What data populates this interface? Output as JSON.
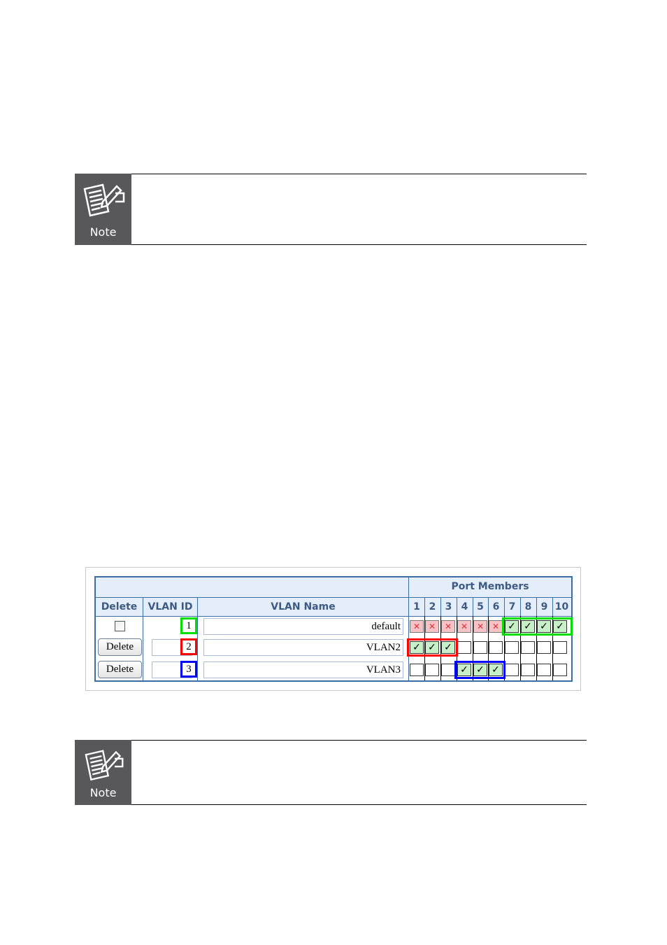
{
  "notes": [
    {
      "label": "Note",
      "icon": "note-pencil-icon"
    },
    {
      "label": "Note",
      "icon": "note-pencil-icon"
    }
  ],
  "vlan_table": {
    "group_header": "Port Members",
    "headers": {
      "delete": "Delete",
      "vlan_id": "VLAN ID",
      "vlan_name": "VLAN Name"
    },
    "ports": [
      "1",
      "2",
      "3",
      "4",
      "5",
      "6",
      "7",
      "8",
      "9",
      "10"
    ],
    "rows": [
      {
        "delete_type": "checkbox",
        "delete_label": "",
        "vlan_id": "1",
        "vlan_name": "default",
        "id_highlight": "#00e000",
        "members": [
          "no",
          "no",
          "no",
          "no",
          "no",
          "no",
          "yes",
          "yes",
          "yes",
          "yes"
        ]
      },
      {
        "delete_type": "button",
        "delete_label": "Delete",
        "vlan_id": "2",
        "vlan_name": "VLAN2",
        "id_highlight": "#ff0000",
        "members": [
          "yes",
          "yes",
          "yes",
          "none",
          "none",
          "none",
          "none",
          "none",
          "none",
          "none"
        ]
      },
      {
        "delete_type": "button",
        "delete_label": "Delete",
        "vlan_id": "3",
        "vlan_name": "VLAN3",
        "id_highlight": "#0000ff",
        "members": [
          "none",
          "none",
          "none",
          "yes",
          "yes",
          "yes",
          "none",
          "none",
          "none",
          "none"
        ]
      }
    ],
    "highlights": [
      {
        "row": 0,
        "from_port": 7,
        "to_port": 10,
        "color": "#00e000"
      },
      {
        "row": 1,
        "from_port": 1,
        "to_port": 3,
        "color": "#ff0000"
      },
      {
        "row": 2,
        "from_port": 4,
        "to_port": 6,
        "color": "#0000ff"
      }
    ],
    "symbols": {
      "yes": "✓",
      "no": "✕"
    },
    "colors": {
      "header_bg": "#e4eefa",
      "header_text": "#3e5a82",
      "border": "#3a6ea5",
      "member_yes": "#c8f0c8",
      "member_no": "#f5c3c5"
    }
  }
}
